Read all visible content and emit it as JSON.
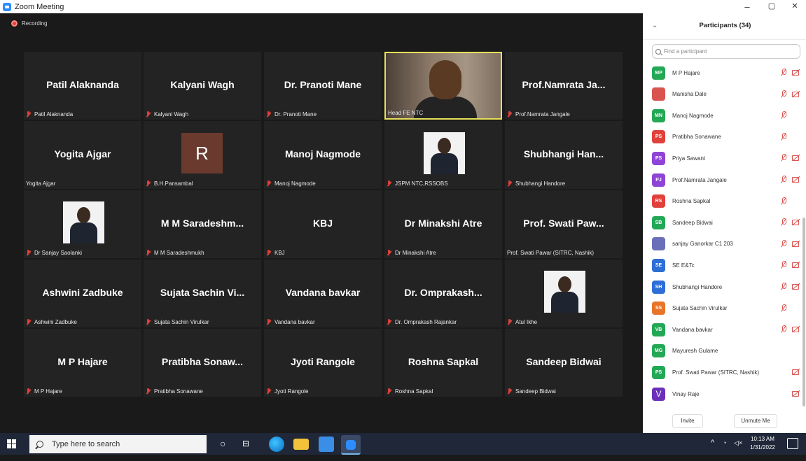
{
  "window": {
    "title": "Zoom Meeting",
    "minimize": "–",
    "restore": "▢",
    "close": "✕"
  },
  "recording": {
    "label": "Recording"
  },
  "tiles": [
    {
      "big": "Patil Alaknanda",
      "small": "Patil Alaknanda",
      "muted": true
    },
    {
      "big": "Kalyani Wagh",
      "small": "Kalyani Wagh",
      "muted": true
    },
    {
      "big": "Dr. Pranoti Mane",
      "small": "Dr. Pranoti Mane",
      "muted": true
    },
    {
      "big": "",
      "small": "Head FE NTC",
      "muted": false,
      "video": true
    },
    {
      "big": "Prof.Namrata Ja...",
      "small": "Prof.Namrata Jangale",
      "muted": true
    },
    {
      "big": "Yogita Ajgar",
      "small": "Yogita Ajgar",
      "muted": false
    },
    {
      "big": "",
      "small": "B.H.Pansambal",
      "muted": true,
      "avatar_letter": "R"
    },
    {
      "big": "Manoj Nagmode",
      "small": "Manoj Nagmode",
      "muted": true
    },
    {
      "big": "",
      "small": "JSPM NTC,RSSOBS",
      "muted": true,
      "photo": true
    },
    {
      "big": "Shubhangi Han...",
      "small": "Shubhangi Handore",
      "muted": true
    },
    {
      "big": "",
      "small": "Dr Sanjay Saolanki",
      "muted": true,
      "photo": true
    },
    {
      "big": "M M Saradeshm...",
      "small": "M M Saradeshmukh",
      "muted": true
    },
    {
      "big": "KBJ",
      "small": "KBJ",
      "muted": true
    },
    {
      "big": "Dr Minakshi Atre",
      "small": "Dr Minakshi Atre",
      "muted": true
    },
    {
      "big": "Prof. Swati Paw...",
      "small": "Prof. Swati Pawar (SITRC, Nashik)",
      "muted": false
    },
    {
      "big": "Ashwini Zadbuke",
      "small": "Ashwini Zadbuke",
      "muted": true
    },
    {
      "big": "Sujata Sachin Vi...",
      "small": "Sujata Sachin Virulkar",
      "muted": true
    },
    {
      "big": "Vandana bavkar",
      "small": "Vandana bavkar",
      "muted": true
    },
    {
      "big": "Dr. Omprakash...",
      "small": "Dr. Omprakash Rajankar",
      "muted": true
    },
    {
      "big": "",
      "small": "Atul Ikhe",
      "muted": true,
      "photo": true
    },
    {
      "big": "M P Hajare",
      "small": "M P Hajare",
      "muted": true
    },
    {
      "big": "Pratibha Sonaw...",
      "small": "Pratibha Sonawane",
      "muted": true
    },
    {
      "big": "Jyoti Rangole",
      "small": "Jyoti Rangole",
      "muted": true
    },
    {
      "big": "Roshna Sapkal",
      "small": "Roshna Sapkal",
      "muted": true
    },
    {
      "big": "Sandeep Bidwai",
      "small": "Sandeep Bidwai",
      "muted": true
    }
  ],
  "panel": {
    "title": "Participants (34)",
    "collapse_icon": "chevron-down-icon",
    "search_placeholder": "Find a participant",
    "participants": [
      {
        "initials": "MP",
        "name": "M P Hajare",
        "color": "#23a855",
        "mic_off": true,
        "cam_off": true
      },
      {
        "initials": "",
        "name": "Manisha Dale",
        "color": "#d9534f",
        "mic_off": true,
        "cam_off": true,
        "photo": true
      },
      {
        "initials": "MN",
        "name": "Manoj Nagmode",
        "color": "#23a855",
        "mic_off": true,
        "cam_off": false
      },
      {
        "initials": "PS",
        "name": "Pratibha Sonawane",
        "color": "#e0413a",
        "mic_off": true,
        "cam_off": false
      },
      {
        "initials": "PS",
        "name": "Priya Sawant",
        "color": "#8e44d6",
        "mic_off": true,
        "cam_off": true
      },
      {
        "initials": "PJ",
        "name": "Prof.Namrata Jangale",
        "color": "#8e44d6",
        "mic_off": true,
        "cam_off": true
      },
      {
        "initials": "RS",
        "name": "Roshna Sapkal",
        "color": "#e0413a",
        "mic_off": true,
        "cam_off": false
      },
      {
        "initials": "SB",
        "name": "Sandeep Bidwai",
        "color": "#23a855",
        "mic_off": true,
        "cam_off": true
      },
      {
        "initials": "",
        "name": "sanjay Ganorkar C1 203",
        "color": "#6a6fb8",
        "mic_off": true,
        "cam_off": true,
        "photo": true
      },
      {
        "initials": "SE",
        "name": "SE E&Tc",
        "color": "#2d6fd6",
        "mic_off": true,
        "cam_off": true
      },
      {
        "initials": "SH",
        "name": "Shubhangi Handore",
        "color": "#2d6fd6",
        "mic_off": true,
        "cam_off": true
      },
      {
        "initials": "SS",
        "name": "Sujata Sachin Virulkar",
        "color": "#e8742a",
        "mic_off": true,
        "cam_off": false
      },
      {
        "initials": "VB",
        "name": "Vandana bavkar",
        "color": "#23a855",
        "mic_off": true,
        "cam_off": true
      },
      {
        "initials": "MG",
        "name": "Mayuresh Gulame",
        "color": "#23a855",
        "mic_off": false,
        "cam_off": false
      },
      {
        "initials": "PS",
        "name": "Prof. Swati Pawar (SITRC, Nashik)",
        "color": "#23a855",
        "mic_off": false,
        "cam_off": true
      },
      {
        "initials": "V",
        "name": "Vinay Raje",
        "color": "#6b2fb8",
        "mic_off": false,
        "cam_off": true,
        "big": true
      }
    ],
    "invite_label": "Invite",
    "unmute_label": "Unmute Me"
  },
  "taskbar": {
    "search_placeholder": "Type here to search",
    "time": "10:13 AM",
    "date": "1/31/2022"
  }
}
